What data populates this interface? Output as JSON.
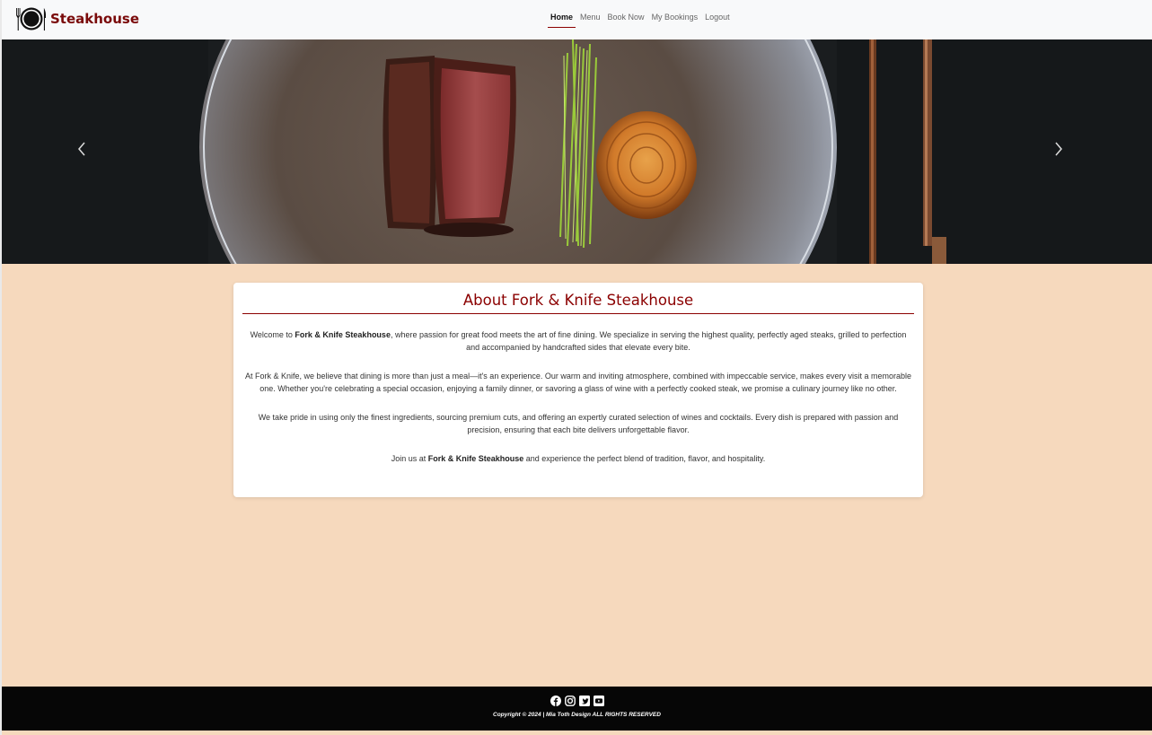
{
  "brand": {
    "name": "Steakhouse",
    "logo_icon": "plate-fork-knife-icon",
    "color": "#7a0a0a"
  },
  "nav": {
    "items": [
      {
        "label": "Home",
        "active": true
      },
      {
        "label": "Menu",
        "active": false
      },
      {
        "label": "Book Now",
        "active": false
      },
      {
        "label": "My Bookings",
        "active": false
      },
      {
        "label": "Logout",
        "active": false
      }
    ]
  },
  "hero": {
    "image": "steak-plate-photo",
    "prev_icon": "chevron-left-icon",
    "next_icon": "chevron-right-icon"
  },
  "about": {
    "title": "About Fork & Knife Steakhouse",
    "p1_pre": "Welcome to ",
    "p1_bold": "Fork & Knife Steakhouse",
    "p1_post": ", where passion for great food meets the art of fine dining. We specialize in serving the highest quality, perfectly aged steaks, grilled to perfection and accompanied by handcrafted sides that elevate every bite.",
    "p2": "At Fork & Knife, we believe that dining is more than just a meal—it's an experience. Our warm and inviting atmosphere, combined with impeccable service, makes every visit a memorable one. Whether you're celebrating a special occasion, enjoying a family dinner, or savoring a glass of wine with a perfectly cooked steak, we promise a culinary journey like no other.",
    "p3": "We take pride in using only the finest ingredients, sourcing premium cuts, and offering an expertly curated selection of wines and cocktails. Every dish is prepared with passion and precision, ensuring that each bite delivers unforgettable flavor.",
    "p4_pre": "Join us at ",
    "p4_bold": "Fork & Knife Steakhouse",
    "p4_post": " and experience the perfect blend of tradition, flavor, and hospitality."
  },
  "footer": {
    "social": [
      "facebook-icon",
      "instagram-icon",
      "twitter-icon",
      "youtube-icon"
    ],
    "copyright": "Copyright © 2024 | Mia Toth Design ALL RIGHTS RESERVED"
  },
  "colors": {
    "accent": "#8b0000",
    "page_bg": "#f6d9bd",
    "footer_bg": "#060606",
    "navbar_bg": "#f8f9fa"
  }
}
